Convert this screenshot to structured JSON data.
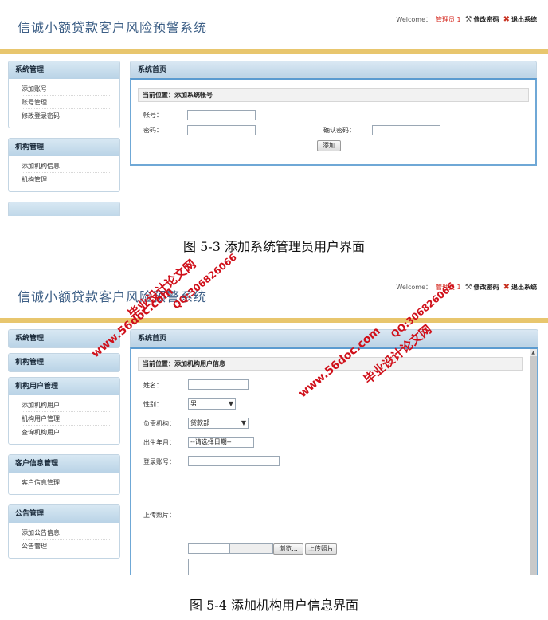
{
  "app_title": "信诚小额贷款客户风险预警系统",
  "topbar": {
    "welcome": "Welcome：",
    "user": "管理员 1",
    "change_password": "修改密码",
    "logout": "退出系统"
  },
  "screen1": {
    "nav": [
      {
        "title": "系统管理",
        "items": [
          "添加账号",
          "账号管理",
          "修改登录密码"
        ]
      },
      {
        "title": "机构管理",
        "items": [
          "添加机构信息",
          "机构管理"
        ]
      },
      {
        "title": "",
        "items": []
      }
    ],
    "main_title": "系统首页",
    "breadcrumb": "当前位置：添加系统帐号",
    "form": {
      "account_label": "帐号：",
      "password_label": "密码：",
      "confirm_label": "确认密码：",
      "add_button": "添加"
    }
  },
  "caption1": "图 5-3 添加系统管理员用户界面",
  "screen2": {
    "nav": [
      {
        "title": "系统管理",
        "items": []
      },
      {
        "title": "机构管理",
        "items": []
      },
      {
        "title": "机构用户管理",
        "items": [
          "添加机构用户",
          "机构用户管理",
          "查询机构用户"
        ]
      },
      {
        "title": "客户信息管理",
        "items": [
          "客户信息管理"
        ]
      },
      {
        "title": "公告管理",
        "items": [
          "添加公告信息",
          "公告管理"
        ]
      }
    ],
    "main_title": "系统首页",
    "breadcrumb": "当前位置：添加机构用户信息",
    "form": {
      "name_label": "姓名：",
      "gender_label": "性别：",
      "gender_value": "男",
      "org_label": "负责机构：",
      "org_value": "贷款部",
      "birth_label": "出生年月：",
      "birth_placeholder": "--请选择日期--",
      "login_label": "登录账号：",
      "photo_label": "上传照片：",
      "browse_button": "浏览...",
      "upload_button": "上传照片"
    }
  },
  "caption2": "图 5-4 添加机构用户信息界面",
  "watermarks": {
    "site1": "www.56doc.com",
    "qq1": "QQ:306826066",
    "name1": "毕业设计论文网",
    "site2": "www.56doc.com",
    "qq2": "QQ:306826066",
    "name2": "毕业设计论文网"
  }
}
